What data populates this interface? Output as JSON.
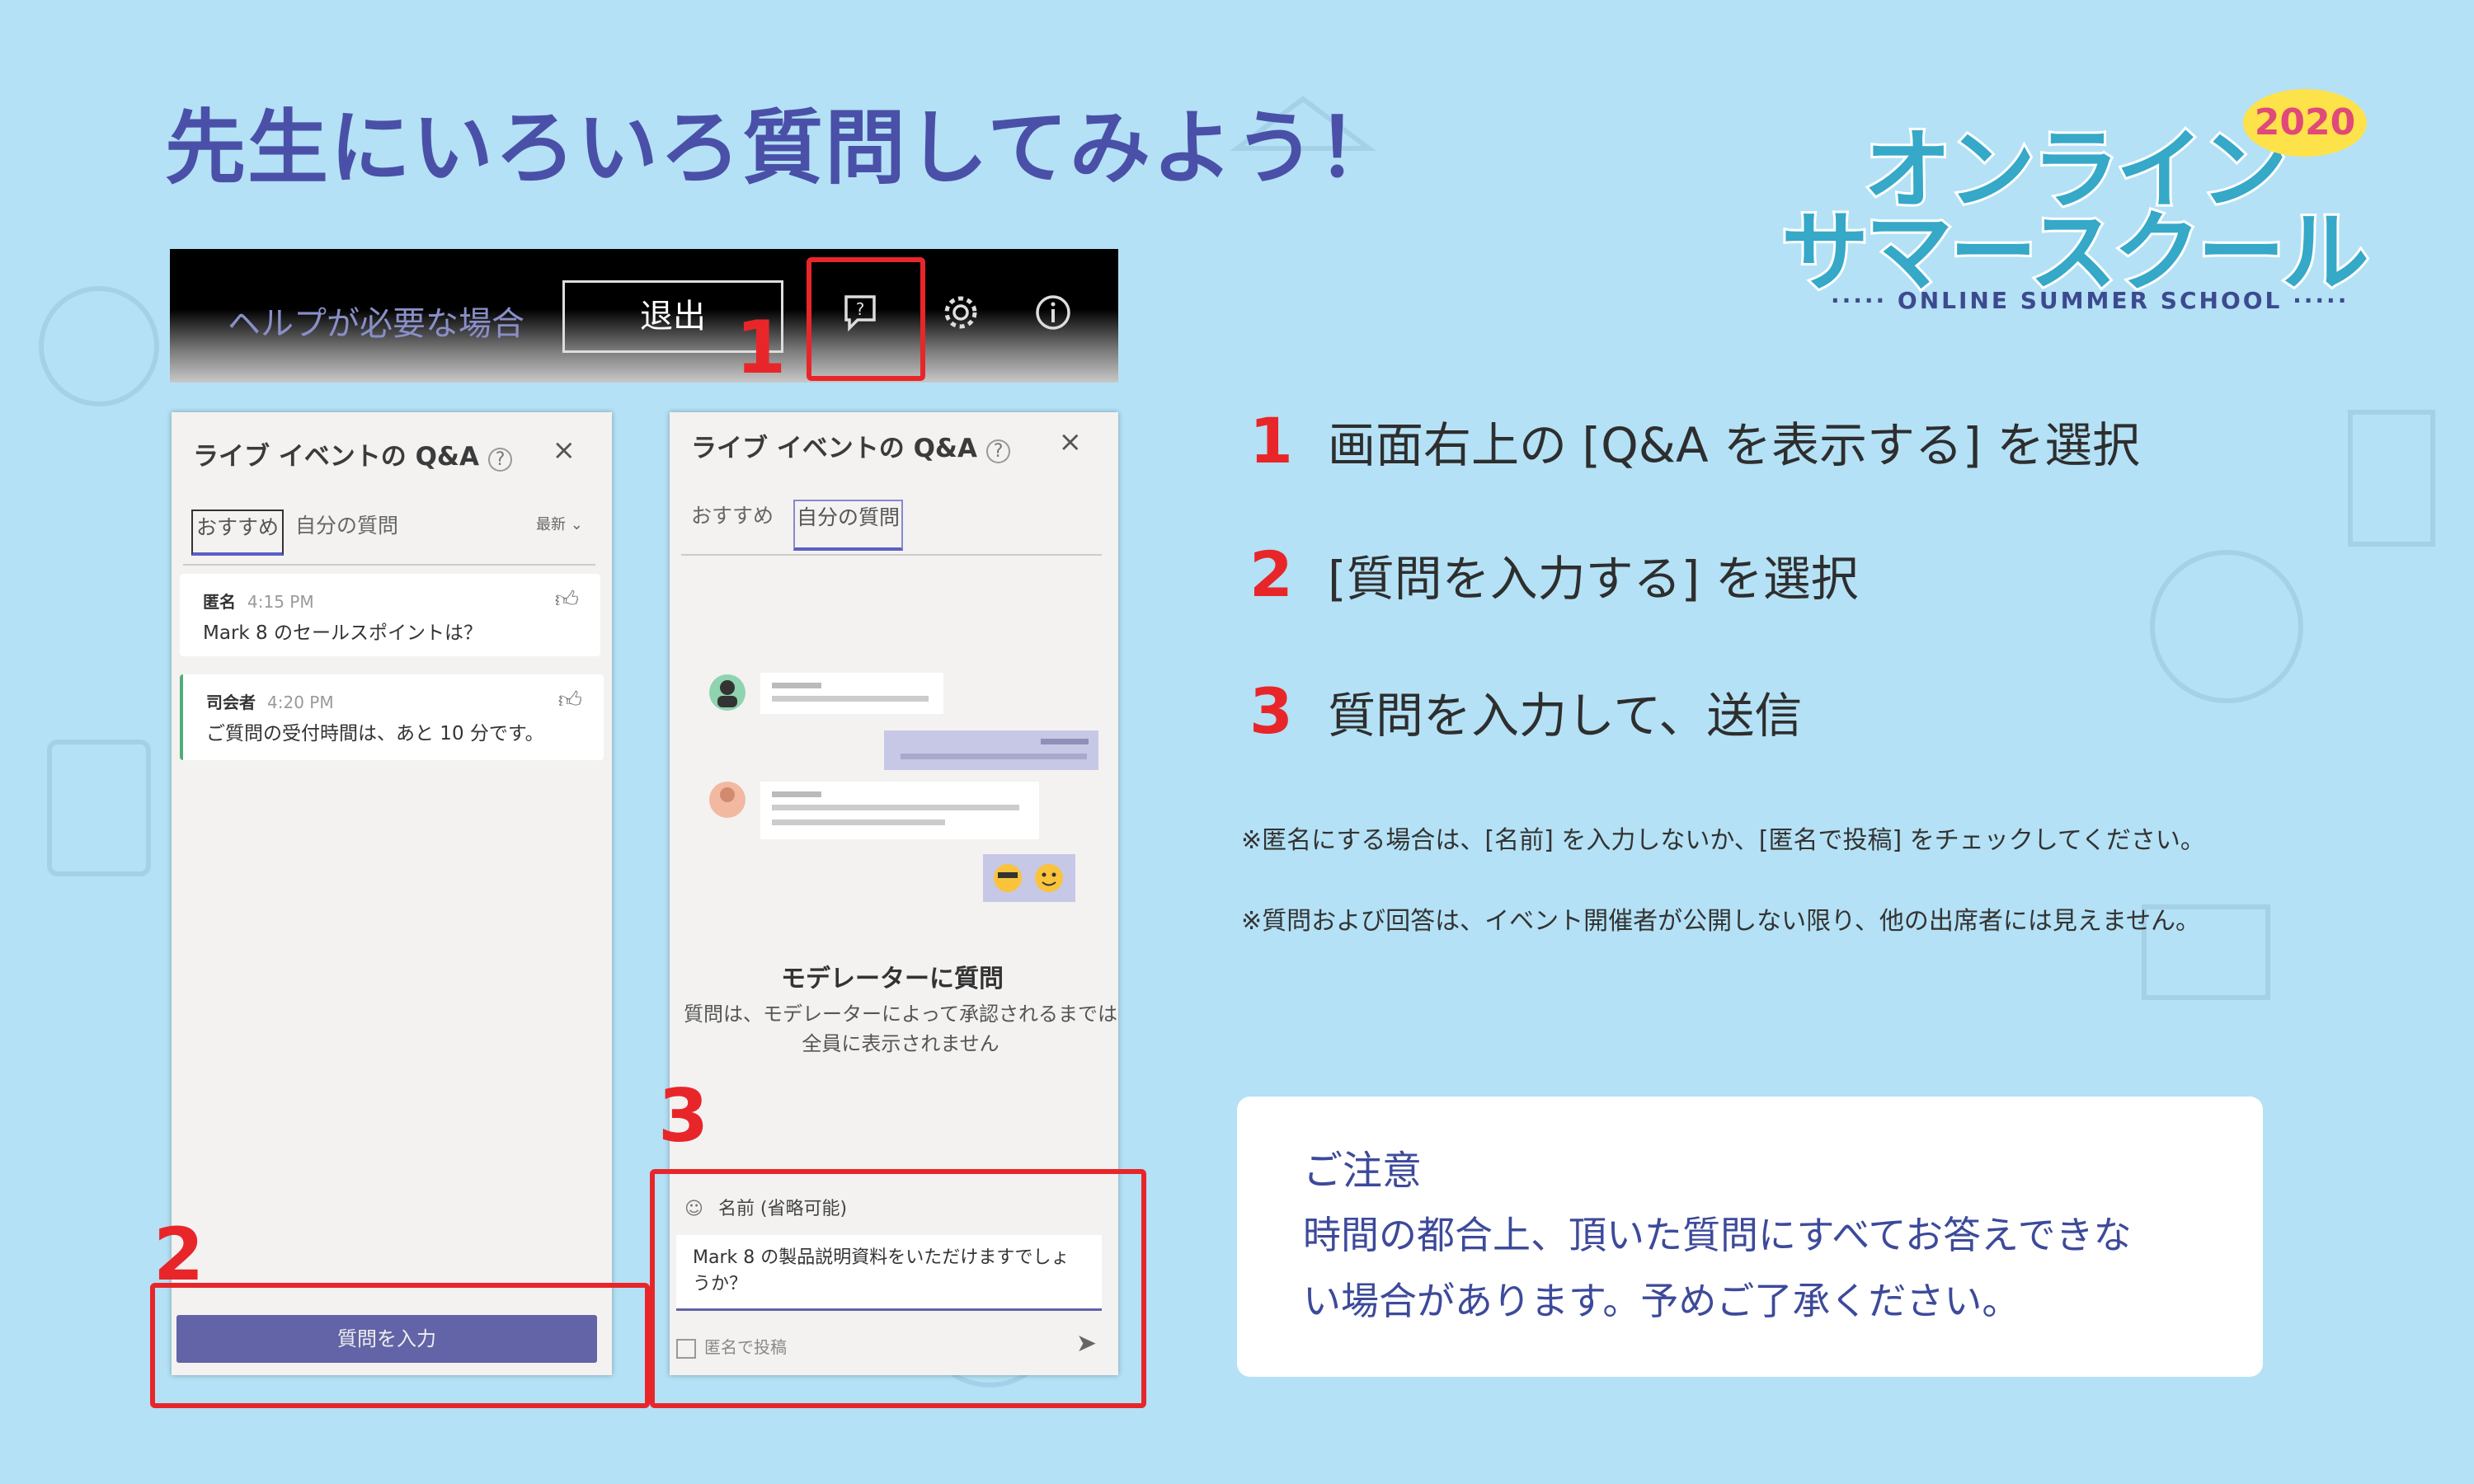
{
  "title": "先生にいろいろ質問してみよう！",
  "logo": {
    "line1": "オンライン",
    "line2": "サマースクール",
    "year": "2020",
    "subtitle": "····· ONLINE SUMMER SCHOOL ·····"
  },
  "toolbar": {
    "help_text": "ヘルプが必要な場合",
    "exit_label": "退出",
    "icons": [
      "qa-icon",
      "gear-icon",
      "info-icon"
    ]
  },
  "callouts": {
    "one": "1",
    "two": "2",
    "three": "3"
  },
  "panel_left": {
    "title": "ライブ イベントの Q&A",
    "help_glyph": "?",
    "close_glyph": "×",
    "tab_recommended": "おすすめ",
    "tab_mine": "自分の質問",
    "sort_label": "最新 ⌄",
    "messages": [
      {
        "name": "匿名",
        "time": "4:15 PM",
        "text": "Mark 8 のセールスポイントは？"
      },
      {
        "name": "司会者",
        "time": "4:20 PM",
        "text": "ご質問の受付時間は、あと 10 分です。"
      }
    ],
    "ask_button": "質問を入力"
  },
  "panel_right": {
    "title": "ライブ イベントの Q&A",
    "help_glyph": "?",
    "close_glyph": "×",
    "tab_recommended": "おすすめ",
    "tab_mine": "自分の質問",
    "moderator_title": "モデレーターに質問",
    "moderator_desc_1": "質問は、モデレーターによって承認されるまでは",
    "moderator_desc_2": "全員に表示されません",
    "name_field": "名前 (省略可能)",
    "question_text": "Mark 8 の製品説明資料をいただけますでしょうか？",
    "anonymous_label": "匿名で投稿"
  },
  "steps": [
    {
      "num": "1",
      "text": "画面右上の [Q&A を表示する] を選択"
    },
    {
      "num": "2",
      "text": "[質問を入力する] を選択"
    },
    {
      "num": "3",
      "text": "質問を入力して、送信"
    }
  ],
  "notes": [
    "※匿名にする場合は、[名前] を入力しないか、[匿名で投稿] をチェックしてください。",
    "※質問および回答は、イベント開催者が公開しない限り、他の出席者には見えません。"
  ],
  "caution": {
    "title": "ご注意",
    "line1": "時間の都合上、頂いた質問にすべてお答えできな",
    "line2": "い場合があります。予めご了承ください。"
  },
  "colors": {
    "background": "#b4e1f5",
    "title": "#4a50a8",
    "highlight_red": "#e8262a",
    "teams_purple": "#6264a7"
  }
}
